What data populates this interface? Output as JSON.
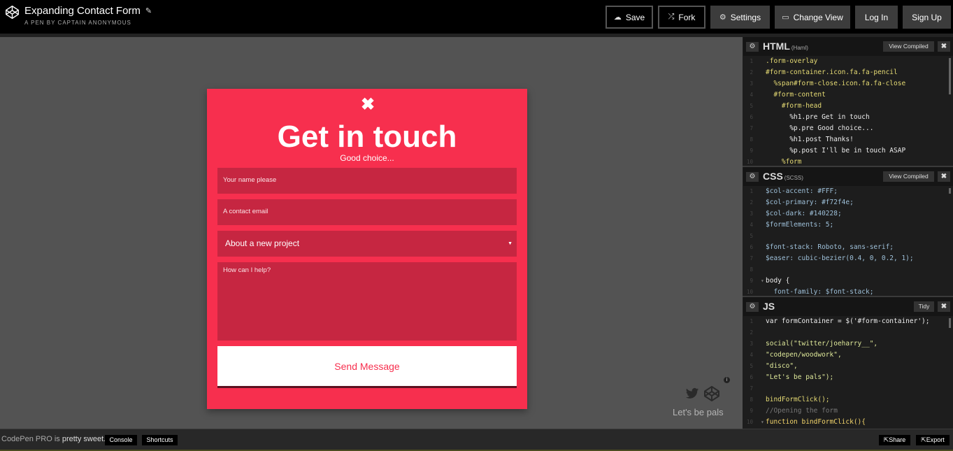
{
  "header": {
    "title": "Expanding Contact Form",
    "subtitle": "A PEN BY CAPTAIN ANONYMOUS",
    "buttons": {
      "save": "Save",
      "fork": "Fork",
      "settings": "Settings",
      "change_view": "Change View",
      "login": "Log In",
      "signup": "Sign Up"
    }
  },
  "preview": {
    "form": {
      "title": "Get in touch",
      "subtitle": "Good choice...",
      "name_placeholder": "Your name please",
      "email_placeholder": "A contact email",
      "subject_value": "About a new project",
      "message_placeholder": "How can I help?",
      "send_label": "Send Message"
    },
    "social_text": "Let's be pals",
    "colors": {
      "primary": "#f72f4e",
      "field": "#c62641",
      "background": "#535353"
    }
  },
  "editors": {
    "html": {
      "title": "HTML",
      "preprocessor": "(Haml)",
      "action": "View Compiled",
      "lines": [
        ".form-overlay",
        "#form-container.icon.fa.fa-pencil",
        "  %span#form-close.icon.fa.fa-close",
        "  #form-content",
        "    #form-head",
        "      %h1.pre Get in touch",
        "      %p.pre Good choice...",
        "      %h1.post Thanks!",
        "      %p.post I'll be in touch ASAP",
        "    %form"
      ]
    },
    "css": {
      "title": "CSS",
      "preprocessor": "(SCSS)",
      "action": "View Compiled",
      "lines": [
        "$col-accent: #FFF;",
        "$col-primary: #f72f4e;",
        "$col-dark: #140228;",
        "$formElements: 5;",
        "",
        "$font-stack: Roboto, sans-serif;",
        "$easer: cubic-bezier(0.4, 0, 0.2, 1);",
        "",
        "body {",
        "  font-family: $font-stack;"
      ]
    },
    "js": {
      "title": "JS",
      "action": "Tidy",
      "lines": [
        "var formContainer = $('#form-container');",
        "",
        "social(\"twitter/joeharry__\",",
        "\"codepen/woodwork\",",
        "\"disco\",",
        "\"Let's be pals\");",
        "",
        "bindFormClick();",
        "//Opening the form",
        "function bindFormClick(){"
      ]
    }
  },
  "footer": {
    "promo_prefix": "CodePen PRO is",
    "promo_strong": "pretty sweet.",
    "console": "Console",
    "shortcuts": "Shortcuts",
    "share": "Share",
    "export": "Export"
  }
}
